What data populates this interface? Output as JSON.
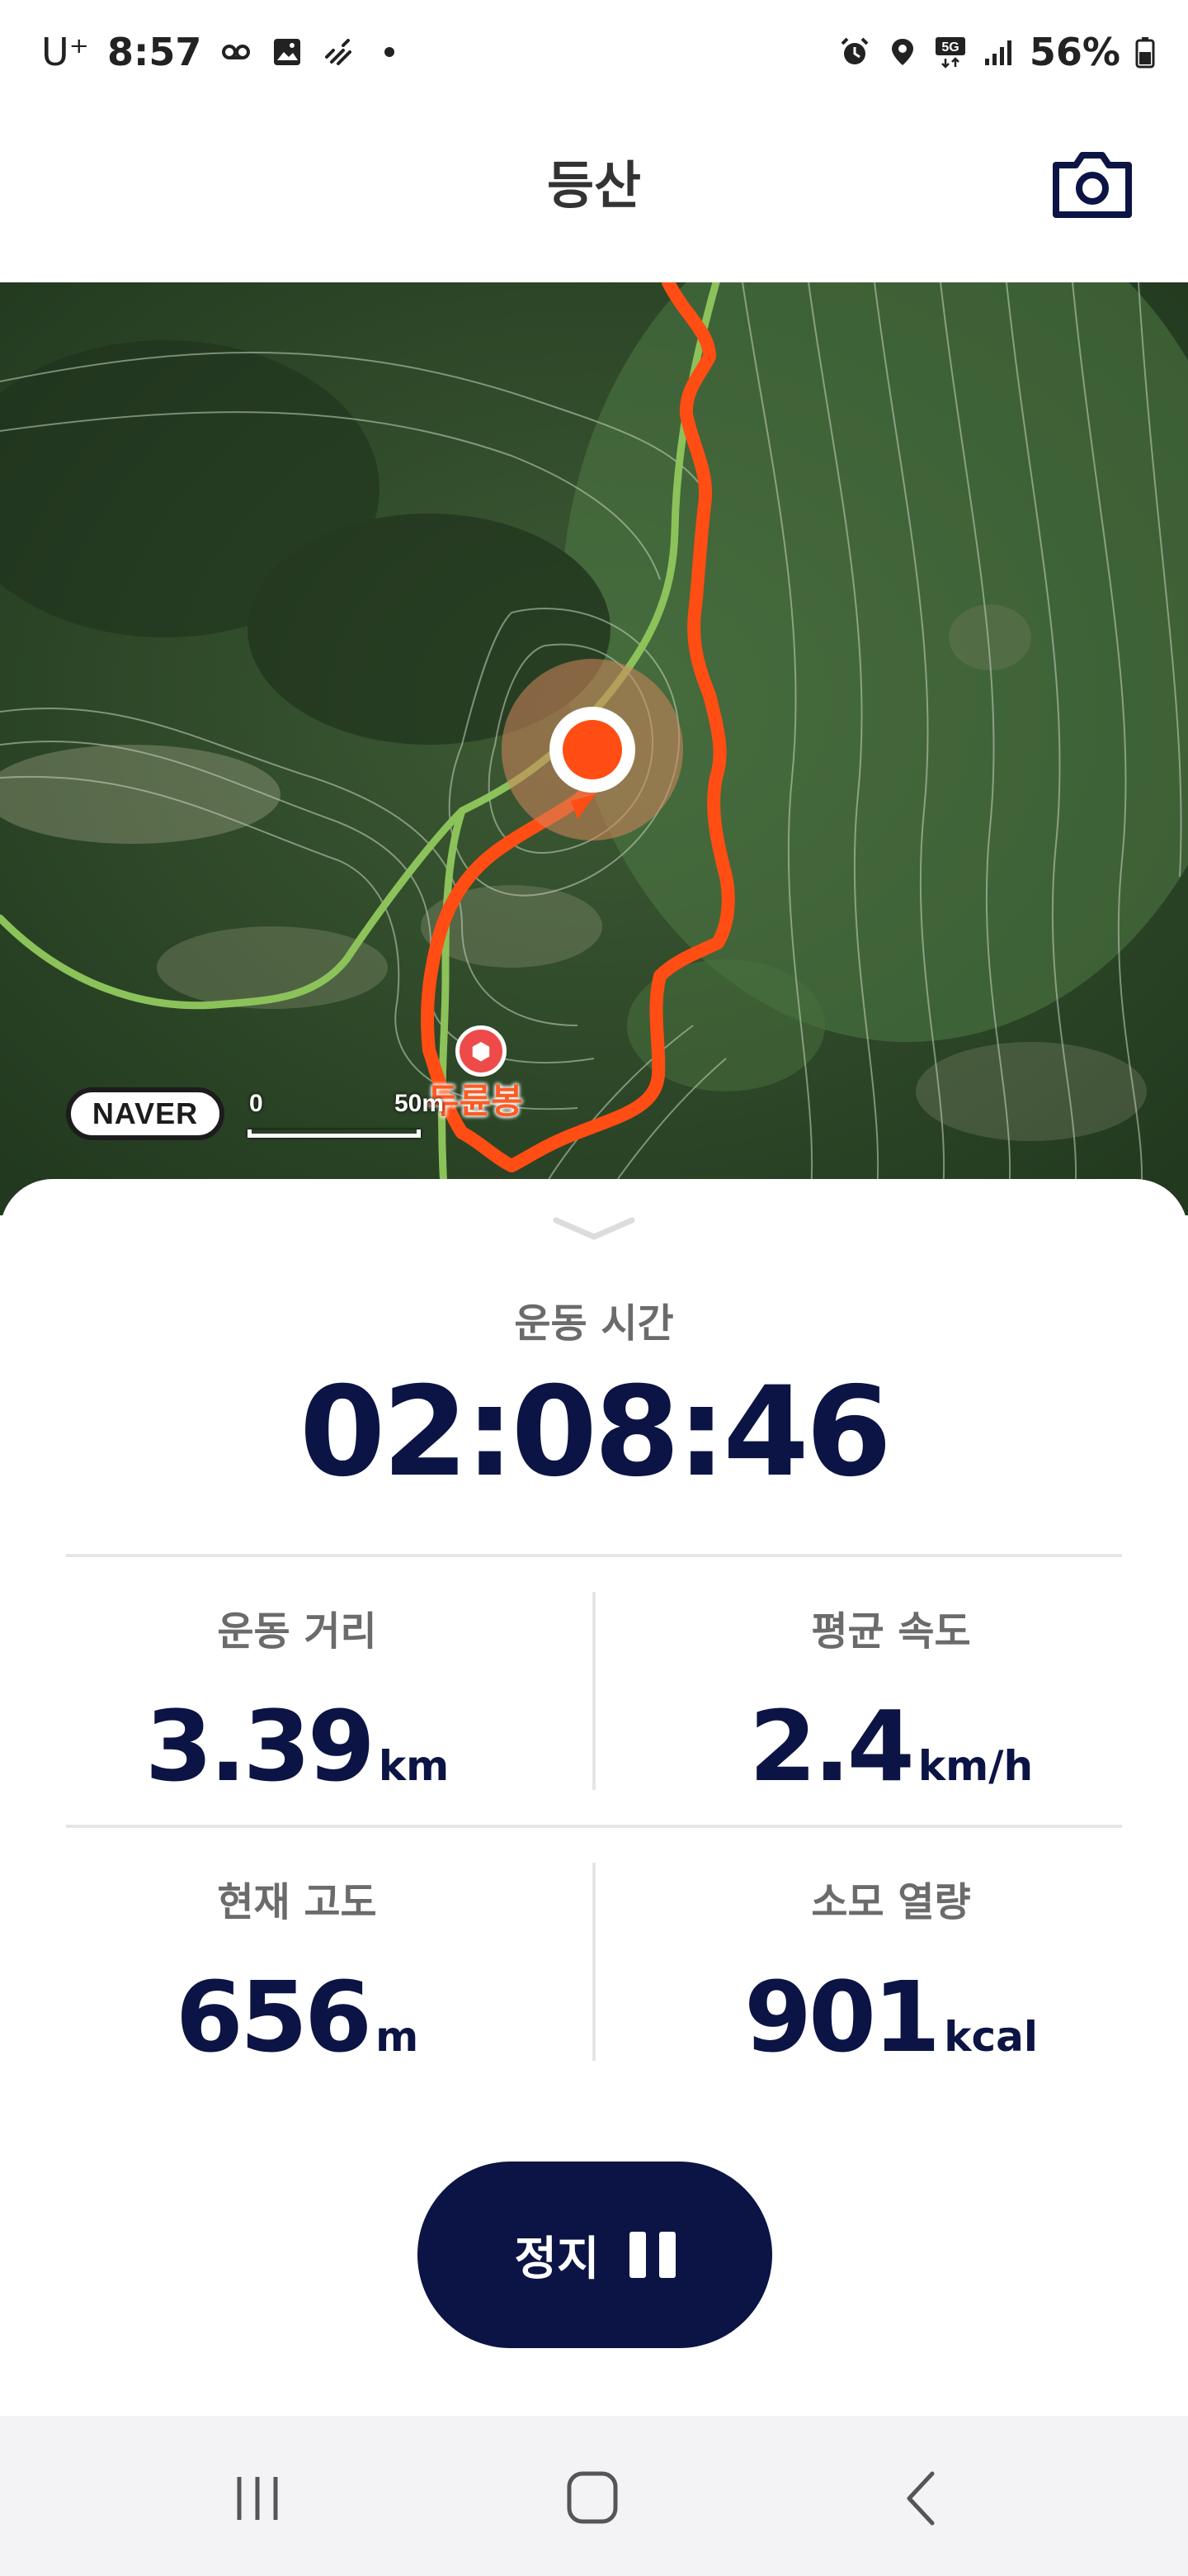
{
  "status_bar": {
    "carrier": "U⁺",
    "time": "8:57",
    "network": "5G",
    "battery": "56%",
    "icons": [
      "voicemail-icon",
      "gallery-icon",
      "mute-icon",
      "notification-dot-icon",
      "alarm-icon",
      "location-icon",
      "5g-icon",
      "signal-icon",
      "battery-icon"
    ]
  },
  "header": {
    "title": "등산",
    "camera_icon": "camera-icon"
  },
  "map": {
    "peak_name": "두륜봉",
    "provider": "NAVER",
    "scale_start": "0",
    "scale_end": "50m",
    "route_color": "#ff4d14",
    "trail_color": "#8cc25a"
  },
  "workout": {
    "time_label": "운동 시간",
    "time_value": "02:08:46",
    "distance_label": "운동 거리",
    "distance_value": "3.39",
    "distance_unit": "km",
    "speed_label": "평균 속도",
    "speed_value": "2.4",
    "speed_unit": "km/h",
    "altitude_label": "현재 고도",
    "altitude_value": "656",
    "altitude_unit": "m",
    "calories_label": "소모 열량",
    "calories_value": "901",
    "calories_unit": "kcal"
  },
  "controls": {
    "stop_label": "정지",
    "pause_icon": "pause-icon"
  },
  "nav_bar": {
    "items": [
      "recent-apps-icon",
      "home-icon",
      "back-icon"
    ]
  },
  "colors": {
    "primary": "#0b1444",
    "label_gray": "#6b6b6b",
    "accent": "#ff4d14"
  }
}
